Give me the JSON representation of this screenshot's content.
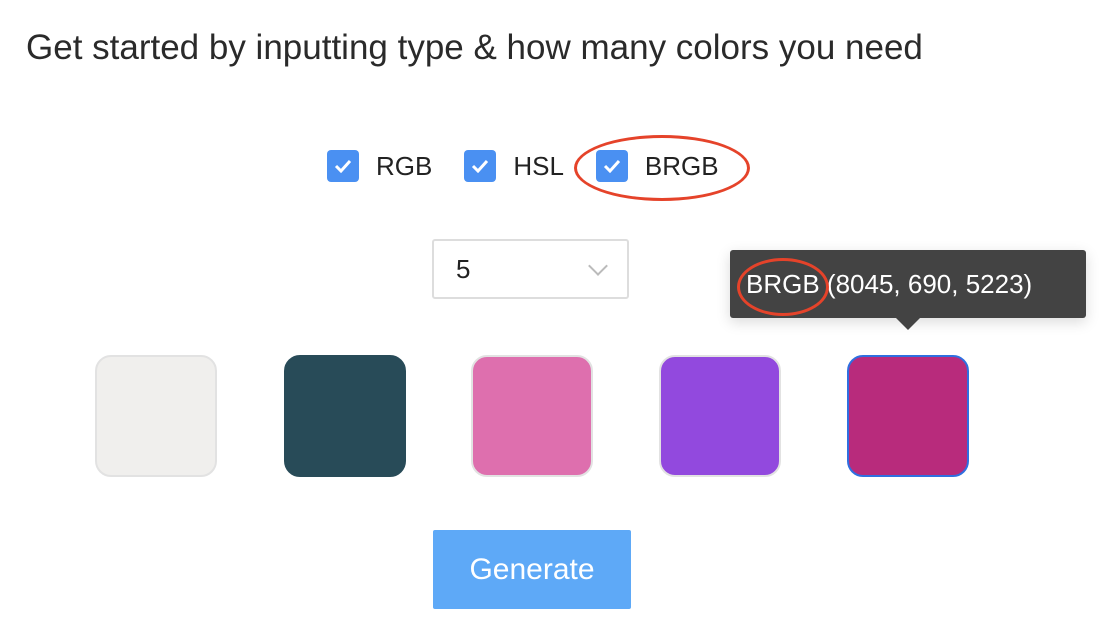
{
  "title": "Get started by inputting type & how many colors you need",
  "types": [
    {
      "label": "RGB",
      "checked": true
    },
    {
      "label": "HSL",
      "checked": true
    },
    {
      "label": "BRGB",
      "checked": true
    }
  ],
  "count_select": {
    "value": "5"
  },
  "swatches": [
    {
      "color": "#f0efed"
    },
    {
      "color": "#284b58"
    },
    {
      "color": "#de6fae"
    },
    {
      "color": "#9249de"
    },
    {
      "color": "#b82b7c",
      "selected": true
    }
  ],
  "tooltip": {
    "type": "BRGB",
    "values": "(8045, 690, 5223)"
  },
  "generate_label": "Generate",
  "annotation_color": "#e5432a"
}
